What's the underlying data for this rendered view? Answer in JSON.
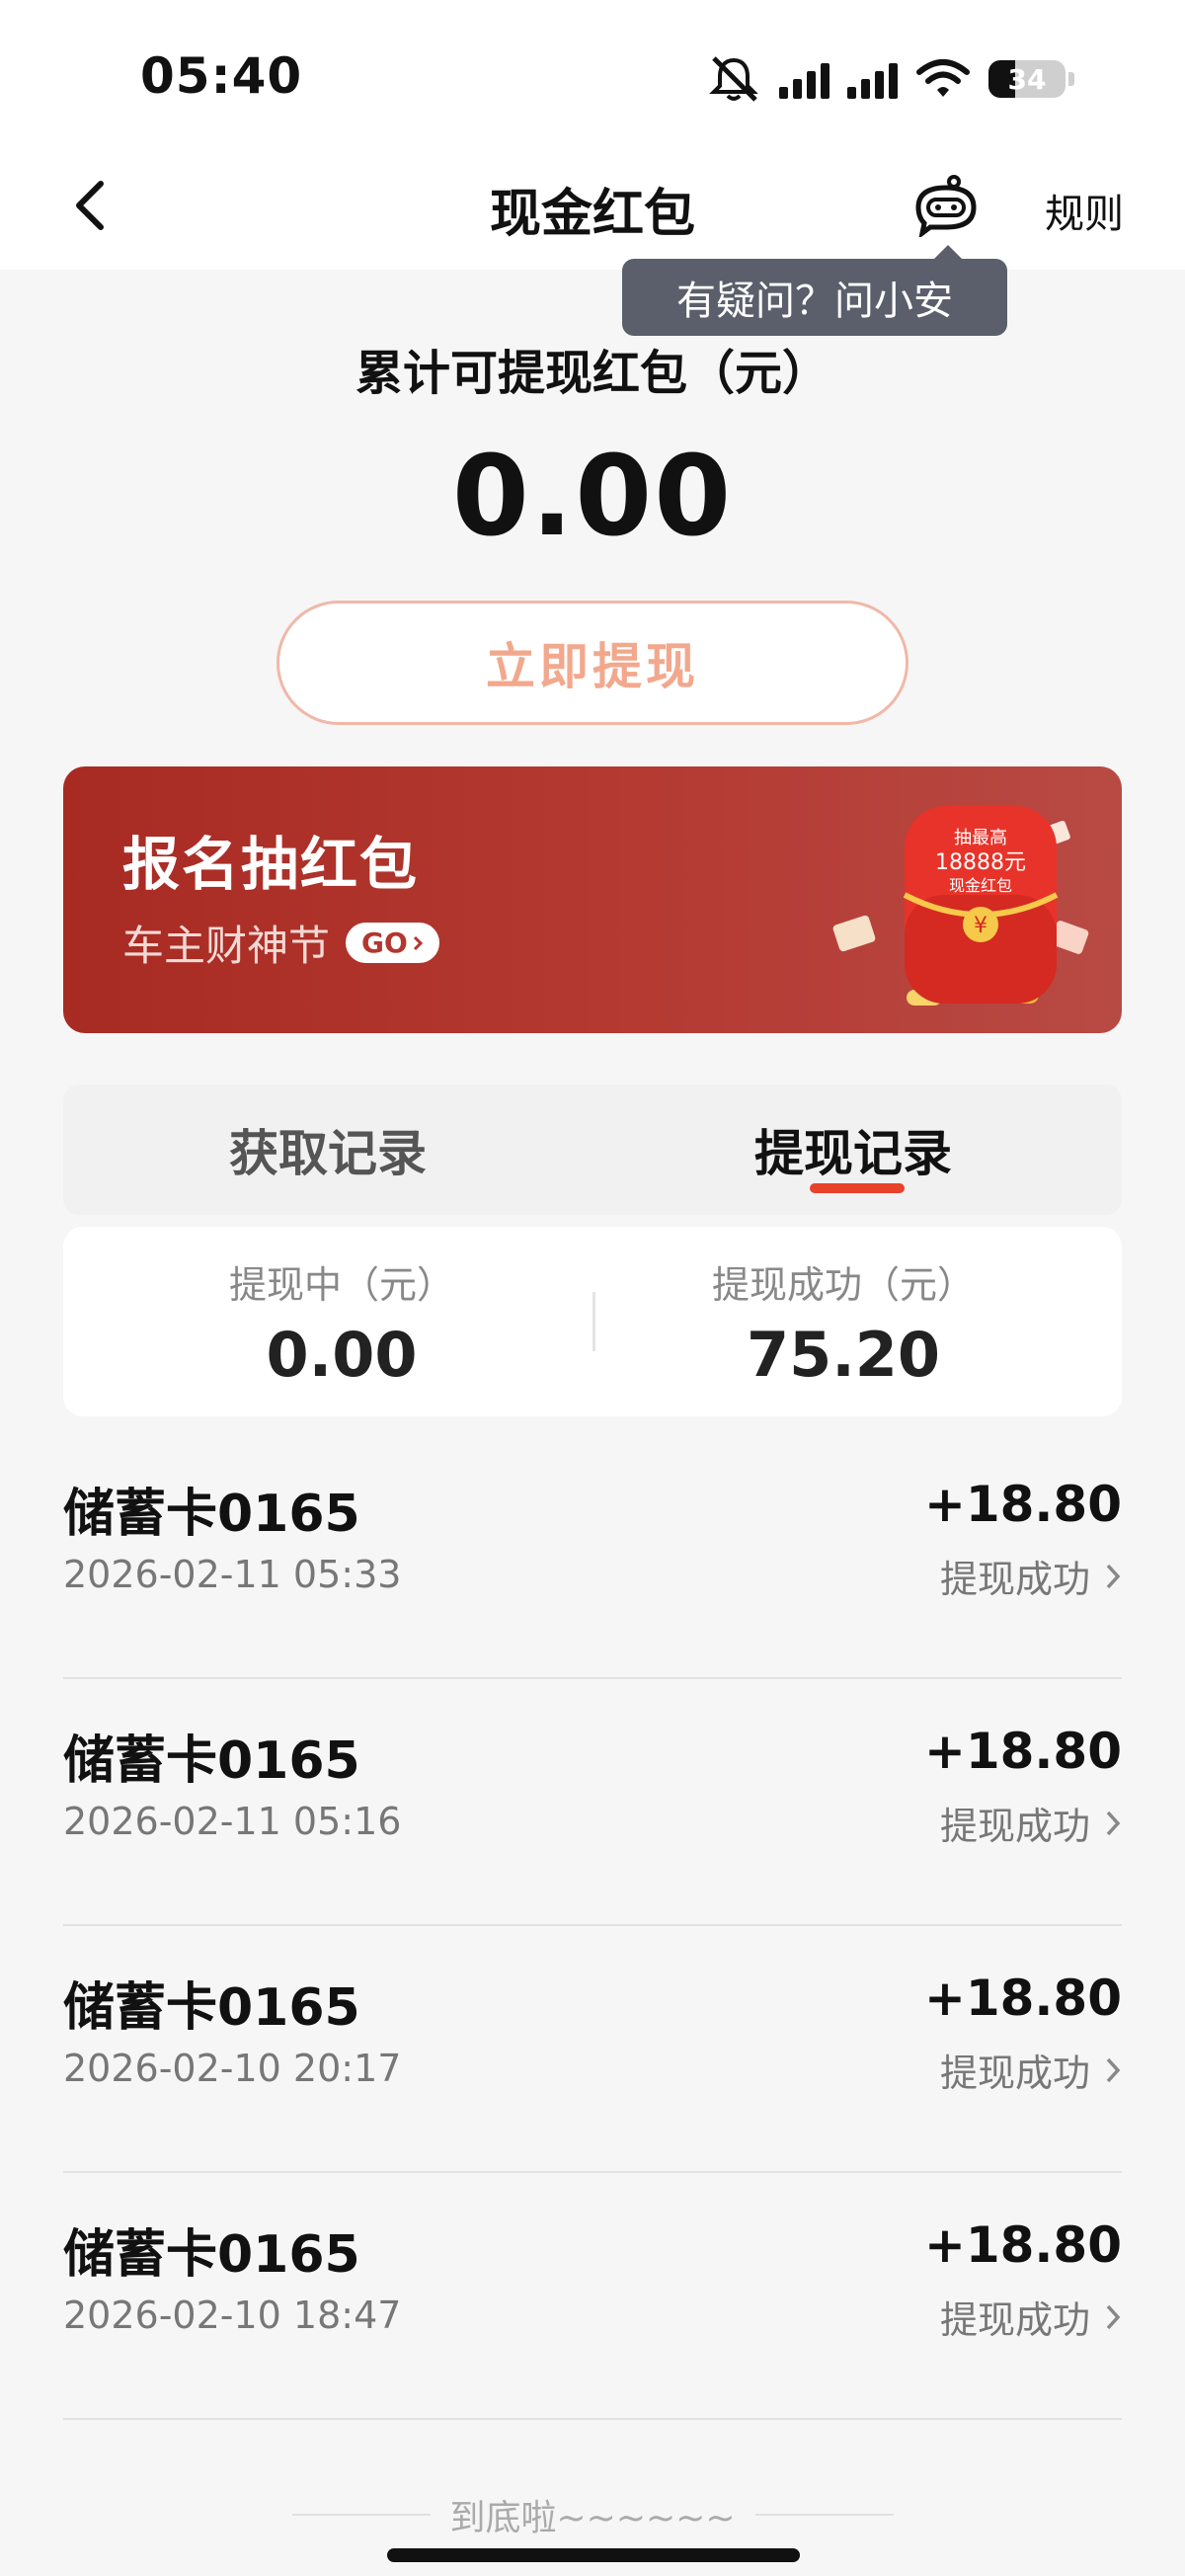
{
  "status_bar": {
    "time": "05:40",
    "battery": "34"
  },
  "nav": {
    "title": "现金红包",
    "rules": "规则"
  },
  "tooltip": "有疑问？问小安",
  "summary": {
    "label": "累计可提现红包（元）",
    "amount": "0.00",
    "withdraw_button": "立即提现"
  },
  "banner": {
    "title": "报名抽红包",
    "subtitle": "车主财神节",
    "go": "GO",
    "art_text": [
      "抽最高",
      "18888元",
      "现金红包"
    ]
  },
  "tabs": [
    {
      "label": "获取记录",
      "active": false
    },
    {
      "label": "提现记录",
      "active": true
    }
  ],
  "stats": {
    "pending_label": "提现中（元）",
    "pending_value": "0.00",
    "success_label": "提现成功（元）",
    "success_value": "75.20"
  },
  "records": [
    {
      "name": "储蓄卡0165",
      "date": "2026-02-11 05:33",
      "amount": "+18.80",
      "status": "提现成功"
    },
    {
      "name": "储蓄卡0165",
      "date": "2026-02-11 05:16",
      "amount": "+18.80",
      "status": "提现成功"
    },
    {
      "name": "储蓄卡0165",
      "date": "2026-02-10 20:17",
      "amount": "+18.80",
      "status": "提现成功"
    },
    {
      "name": "储蓄卡0165",
      "date": "2026-02-10 18:47",
      "amount": "+18.80",
      "status": "提现成功"
    }
  ],
  "end_text": "到底啦~~~~~~",
  "colors": {
    "accent": "#e8422b",
    "banner": "#a82b23",
    "button_text": "#f2a88d"
  }
}
